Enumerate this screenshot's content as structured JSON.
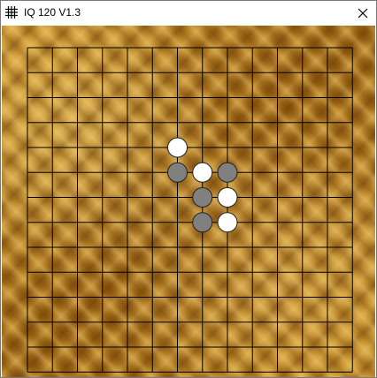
{
  "window": {
    "title": "IQ 120 V1.3",
    "app_icon": "grid-icon",
    "close_icon": "close-icon"
  },
  "board": {
    "grid_lines": 14,
    "line_color": "#000000",
    "colors": {
      "white": "#ffffff",
      "gray": "#808080",
      "stone_outline": "#222222"
    },
    "stones": [
      {
        "color": "white",
        "col": 6,
        "row": 4
      },
      {
        "color": "gray",
        "col": 6,
        "row": 5
      },
      {
        "color": "white",
        "col": 7,
        "row": 5
      },
      {
        "color": "gray",
        "col": 8,
        "row": 5
      },
      {
        "color": "gray",
        "col": 7,
        "row": 6
      },
      {
        "color": "white",
        "col": 8,
        "row": 6
      },
      {
        "color": "gray",
        "col": 7,
        "row": 7
      },
      {
        "color": "white",
        "col": 8,
        "row": 7
      }
    ]
  }
}
